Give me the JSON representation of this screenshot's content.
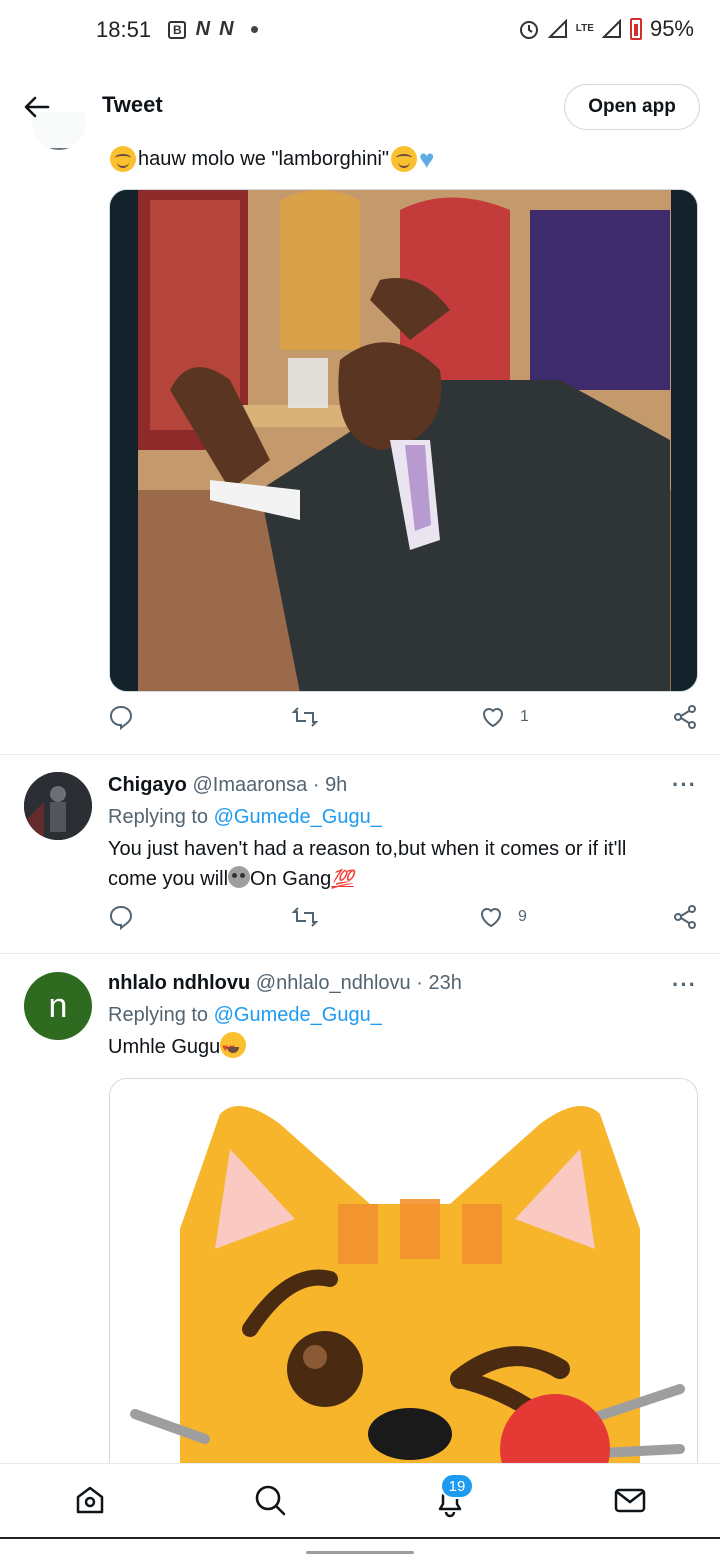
{
  "status_bar": {
    "time": "18:51",
    "notification_icons": [
      "B",
      "N",
      "N"
    ],
    "network": "LTE",
    "battery": "95%"
  },
  "header": {
    "title": "Tweet",
    "open_app_label": "Open app"
  },
  "main_tweet": {
    "text": "hauw molo we \"lamborghini\"",
    "like_count": "1"
  },
  "replies": [
    {
      "name": "Chigayo",
      "handle": "@Imaaronsa",
      "time": "9h",
      "replying_prefix": "Replying to",
      "replying_to": "@Gumede_Gugu_",
      "text_line1": "You just haven't had a reason to,but when it comes or if it'll",
      "text_line2_a": "come you will",
      "text_line2_b": "On Gang",
      "emoji_100": "💯",
      "like_count": "9"
    },
    {
      "name": "nhlalo ndhlovu",
      "handle": "@nhlalo_ndhlovu",
      "time": "23h",
      "avatar_letter": "n",
      "replying_prefix": "Replying to",
      "replying_to": "@Gumede_Gugu_",
      "text": "Umhle Gugu"
    }
  ],
  "bottom_nav": {
    "items": [
      "home-icon",
      "search-icon",
      "notifications-icon",
      "messages-icon"
    ],
    "notification_badge": "19"
  },
  "colors": {
    "accent": "#1d9bf0",
    "secondary_text": "#536471",
    "avatar_green": "#2e6a1f"
  }
}
